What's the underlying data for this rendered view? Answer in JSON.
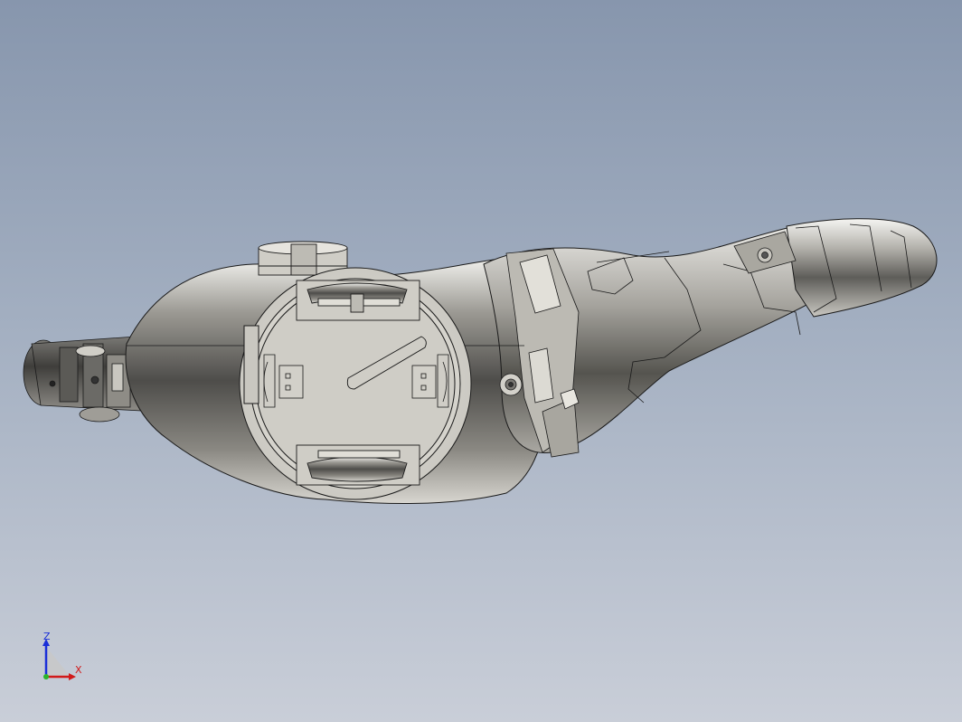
{
  "viewport": {
    "background_top": "#8796ad",
    "background_bottom": "#c9ced8",
    "model_color": "#d9d7d0",
    "edge_color": "#1a1a1a"
  },
  "triad": {
    "z_label": "Z",
    "x_label": "X",
    "z_color": "#1a2fd8",
    "x_color": "#d11a1a",
    "y_color": "#2bb52b"
  }
}
